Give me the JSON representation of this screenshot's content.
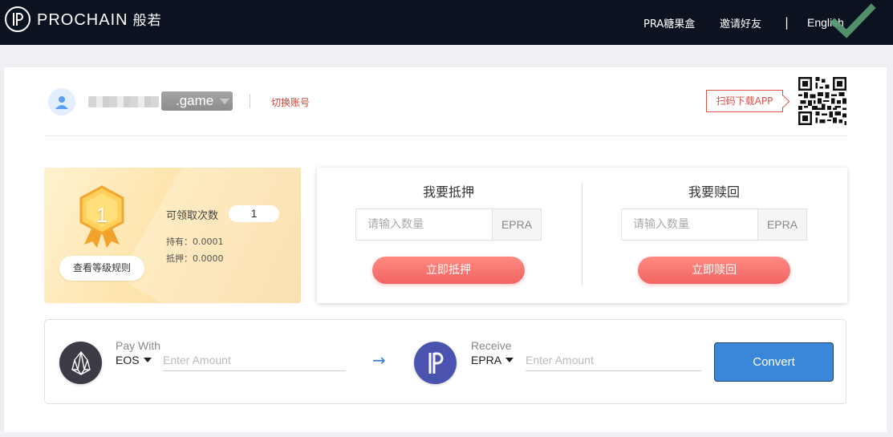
{
  "header": {
    "logo_text": "PROCHAIN",
    "logo_cn": "般若",
    "nav": [
      "PRA糖果盒",
      "邀请好友",
      "English"
    ],
    "nav_sep": "|"
  },
  "user": {
    "account_suffix": ".game",
    "switch_account": "切换账号",
    "scan_download": "扫码下载APP"
  },
  "level": {
    "level": "1",
    "rules_button": "查看等级规则",
    "claim_label": "可领取次数",
    "claim_value": "1",
    "hold": "持有：0.0001",
    "pledge": "抵押：0.0000"
  },
  "stake": {
    "pledge_title": "我要抵押",
    "redeem_title": "我要赎回",
    "amount_placeholder": "请输入数量",
    "unit": "EPRA",
    "pledge_button": "立即抵押",
    "redeem_button": "立即赎回"
  },
  "convert": {
    "pay_label": "Pay With",
    "pay_currency": "EOS",
    "receive_label": "Receive",
    "receive_currency": "EPRA",
    "amount_placeholder": "Enter Amount",
    "arrow": "→",
    "button": "Convert"
  },
  "colors": {
    "header_bg": "#0b1220",
    "accent_red": "#f26462",
    "convert_blue": "#3a86d8",
    "check_green": "#5a9f74"
  }
}
